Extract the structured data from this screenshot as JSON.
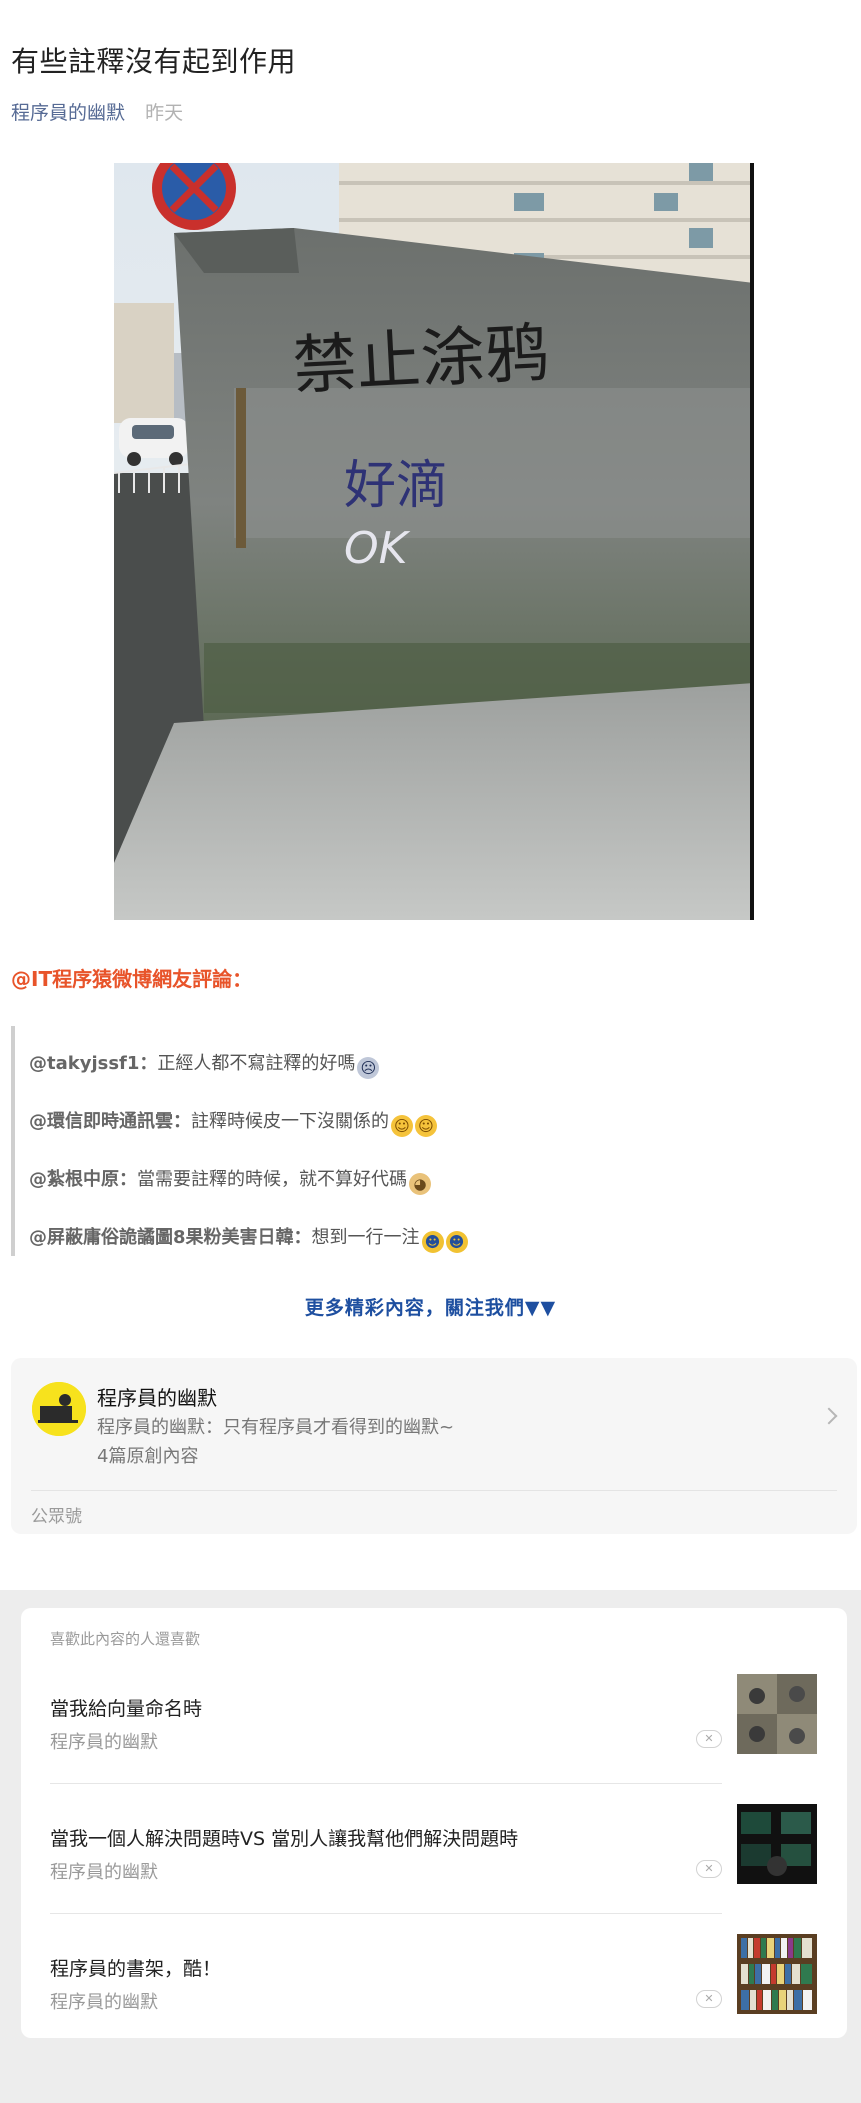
{
  "article": {
    "title": "有些註釋沒有起到作用",
    "author": "程序員的幽默",
    "date": "昨天"
  },
  "photo_text": {
    "sign_text": "禁止涂鸦",
    "reply_text": "好滴",
    "ok_text": "OK"
  },
  "comments": {
    "heading": "@IT程序猿微博網友評論：",
    "items": [
      {
        "user": "@takyjssf1：",
        "text": "正經人都不寫註釋的好嗎",
        "emoji": [
          "face"
        ]
      },
      {
        "user": "@環信即時通訊雲：",
        "text": "註釋時候皮一下沒關係的",
        "emoji": [
          "laugh",
          "laugh"
        ]
      },
      {
        "user": "@紮根中原：",
        "text": "當需要註釋的時候，就不算好代碼",
        "emoji": [
          "doge"
        ]
      },
      {
        "user": "@屏蔽庸俗詭譎圖8果粉美害日韓：",
        "text": "想到一行一注",
        "emoji": [
          "cry",
          "cry"
        ]
      }
    ],
    "more_link": "更多精彩內容，關注我們▼▼"
  },
  "profile": {
    "name": "程序員的幽默",
    "description": "程序員的幽默：只有程序員才看得到的幽默~",
    "count": "4篇原創內容",
    "type": "公眾號"
  },
  "recommend": {
    "heading": "喜歡此內容的人還喜歡",
    "items": [
      {
        "title": "當我給向量命名時",
        "source": "程序員的幽默",
        "thumb": "cats-photo"
      },
      {
        "title": "當我一個人解決問題時VS 當別人讓我幫他們解決問題時",
        "source": "程序員的幽默",
        "thumb": "monitors-photo"
      },
      {
        "title": "程序員的書架，酷！",
        "source": "程序員的幽默",
        "thumb": "bookshelf-photo"
      }
    ]
  },
  "colors": {
    "author_link": "#576b95",
    "comment_heading": "#e8542a",
    "more_link": "#1e4fa0"
  }
}
